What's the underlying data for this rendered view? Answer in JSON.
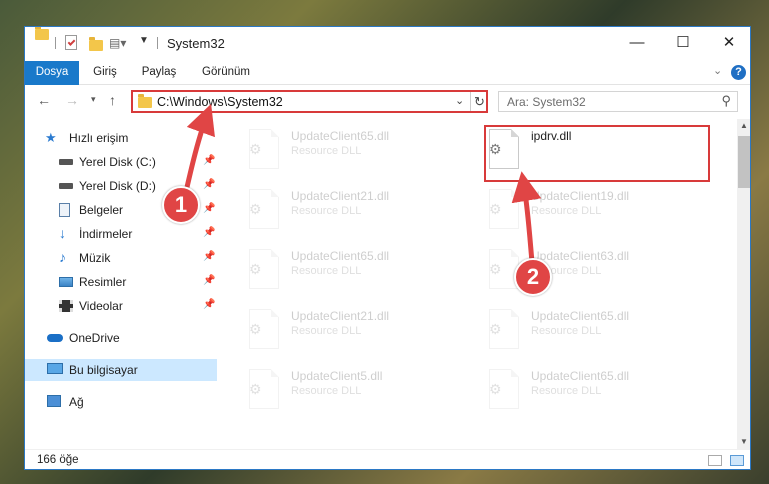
{
  "window": {
    "title": "System32",
    "controls": {
      "minimize": "—",
      "maximize": "☐",
      "close": "✕"
    }
  },
  "ribbon": {
    "tabs": [
      {
        "label": "Dosya",
        "active": true
      },
      {
        "label": "Giriş"
      },
      {
        "label": "Paylaş"
      },
      {
        "label": "Görünüm"
      }
    ],
    "help": "?"
  },
  "address": {
    "path": "C:\\Windows\\System32",
    "refresh_icon": "refresh-icon"
  },
  "search": {
    "placeholder": "Ara: System32"
  },
  "sidebar": {
    "items": [
      {
        "label": "Hızlı erişim",
        "icon": "star-icon"
      },
      {
        "label": "Yerel Disk (C:)",
        "icon": "drive-icon",
        "pinned": true
      },
      {
        "label": "Yerel Disk (D:)",
        "icon": "drive-icon",
        "pinned": true
      },
      {
        "label": "Belgeler",
        "icon": "documents-icon",
        "pinned": true
      },
      {
        "label": "İndirmeler",
        "icon": "download-icon",
        "pinned": true
      },
      {
        "label": "Müzik",
        "icon": "music-icon",
        "pinned": true
      },
      {
        "label": "Resimler",
        "icon": "pictures-icon",
        "pinned": true
      },
      {
        "label": "Videolar",
        "icon": "video-icon",
        "pinned": true
      },
      {
        "label": "OneDrive",
        "icon": "cloud-icon"
      },
      {
        "label": "Bu bilgisayar",
        "icon": "computer-icon",
        "selected": true
      },
      {
        "label": "Ağ",
        "icon": "network-icon"
      }
    ]
  },
  "files": {
    "left": [
      {
        "name": "UpdateClient65.dll",
        "desc": "Resource DLL"
      },
      {
        "name": "UpdateClient21.dll",
        "desc": "Resource DLL"
      },
      {
        "name": "UpdateClient65.dll",
        "desc": "Resource DLL"
      },
      {
        "name": "UpdateClient21.dll",
        "desc": "Resource DLL"
      },
      {
        "name": "UpdateClient5.dll",
        "desc": "Resource DLL"
      }
    ],
    "right": [
      {
        "name": "ipdrv.dll",
        "desc": "",
        "highlighted": true
      },
      {
        "name": "UpdateClient19.dll",
        "desc": "Resource DLL"
      },
      {
        "name": "UpdateClient63.dll",
        "desc": "Resource DLL"
      },
      {
        "name": "UpdateClient65.dll",
        "desc": "Resource DLL"
      },
      {
        "name": "UpdateClient65.dll",
        "desc": "Resource DLL"
      }
    ]
  },
  "status": {
    "count": "166 öğe"
  },
  "callouts": {
    "one": "1",
    "two": "2"
  },
  "colors": {
    "accent": "#1979ca",
    "highlight": "#d83a3a",
    "callout": "#e04545"
  }
}
